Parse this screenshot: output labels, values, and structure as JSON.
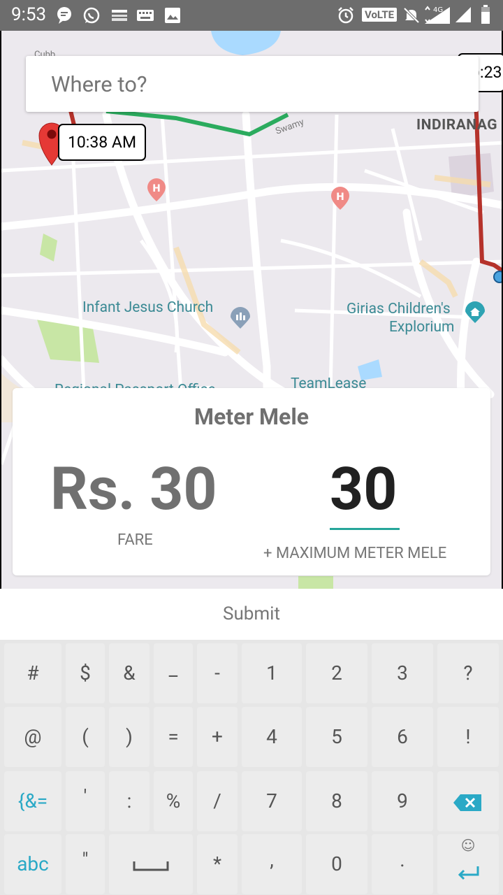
{
  "status_bar": {
    "time": "9:53",
    "icons": [
      "message-icon",
      "whatsapp-icon",
      "amazon-icon",
      "keyboard-icon",
      "image-icon",
      "alarm-icon",
      "volte-badge",
      "mute-icon",
      "signal-4g-icon",
      "signal-icon",
      "battery-icon"
    ],
    "volte": "VoLTE",
    "network": "4G"
  },
  "map": {
    "search_placeholder": "Where to?",
    "pin_time": "10:38 AM",
    "right_time_fragment": "):23",
    "labels": {
      "indiranagar": "INDIRANAG",
      "infant_jesus": "Infant Jesus Church",
      "girias_1": "Girias Children's",
      "girias_2": "Explorium",
      "teamlease": "TeamLease",
      "swamy": "Swamy",
      "cubb": "Cubb",
      "regional": "Regional Passport Office"
    },
    "colors": {
      "route_red": "#b5322b",
      "route_green": "#2bab5e",
      "water": "#aadaff",
      "park": "#c8e6a5"
    }
  },
  "card": {
    "title": "Meter Mele",
    "fare_value": "Rs. 30",
    "fare_label": "FARE",
    "meter_value": "30",
    "meter_label": "+ MAXIMUM METER MELE",
    "accent": "#26a69a"
  },
  "submit_label": "Submit",
  "keyboard": {
    "rows": [
      [
        "#",
        "$",
        "&",
        "_",
        "-",
        "1",
        "2",
        "3",
        "?"
      ],
      [
        "@",
        "(",
        ")",
        "=",
        "+",
        "4",
        "5",
        "6",
        "!"
      ],
      [
        "{&=",
        "'",
        ":",
        "%",
        "/",
        "7",
        "8",
        "9",
        "⌫"
      ],
      [
        "abc",
        "\"",
        "space",
        "*",
        ",",
        "0",
        ".",
        "⏎"
      ]
    ],
    "accent": "#2aa9c6"
  }
}
